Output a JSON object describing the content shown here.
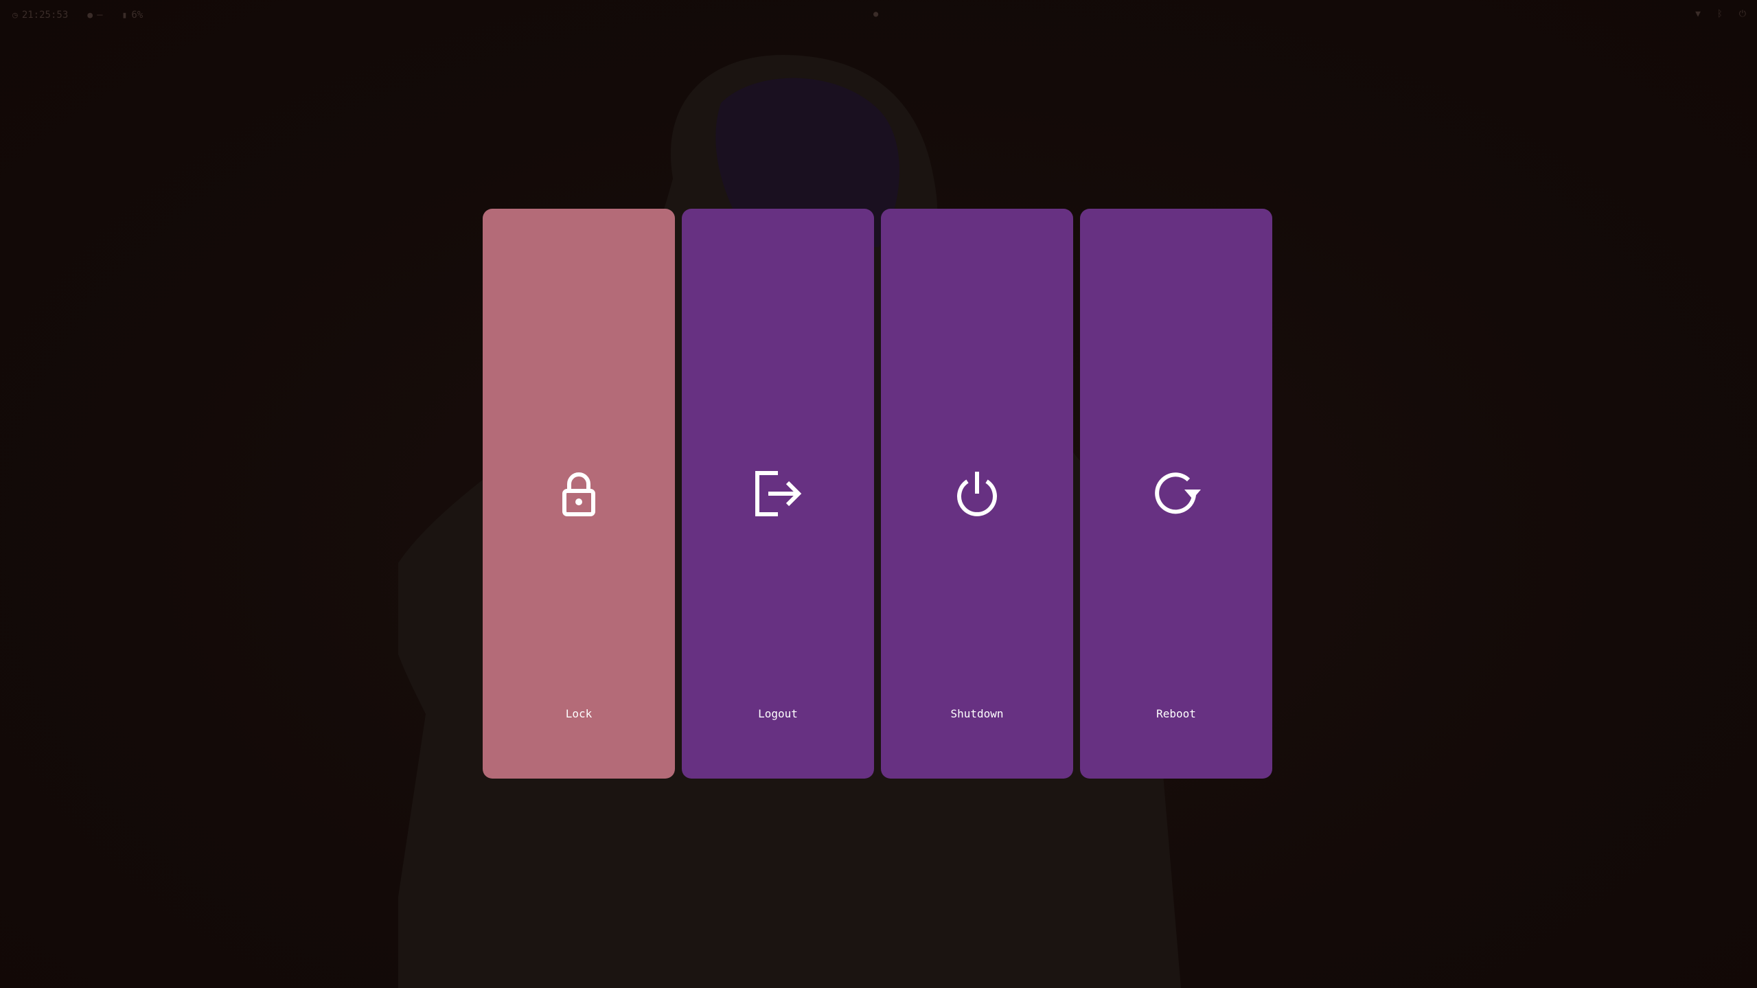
{
  "topbar": {
    "clock": "21:25:53",
    "workspace": "—",
    "battery": "6%"
  },
  "menu": {
    "items": [
      {
        "label": "Lock",
        "icon": "lock-icon",
        "color": "#b46b78"
      },
      {
        "label": "Logout",
        "icon": "logout-icon",
        "color": "#673182"
      },
      {
        "label": "Shutdown",
        "icon": "power-icon",
        "color": "#673182"
      },
      {
        "label": "Reboot",
        "icon": "reboot-icon",
        "color": "#673182"
      }
    ]
  },
  "colors": {
    "tile": "#673182",
    "tile_selected": "#b46b78",
    "backdrop": "#140a08"
  }
}
